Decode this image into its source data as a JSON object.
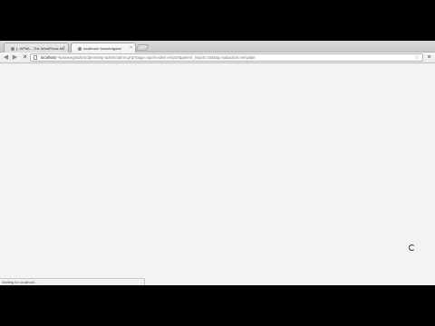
{
  "tabs": [
    {
      "label": "[- WPML - The WordPress Mu",
      "close": "×"
    },
    {
      "label": "localhost/~kassenigota/",
      "close": "×"
    }
  ],
  "toolbar": {
    "back_icon": "◀",
    "forward_icon": "▶",
    "stop_icon": "✕",
    "menu_icon": "≡",
    "bookmark_icon": "☆"
  },
  "omnibox": {
    "host": "localhost",
    "path": "/~kassenigota/wordpress/wp-admin/admin.php?page=wpml-admin-import&parent_import=15&tag=ea&action=template"
  },
  "status_bar": {
    "text": "Waiting for localhost..."
  }
}
